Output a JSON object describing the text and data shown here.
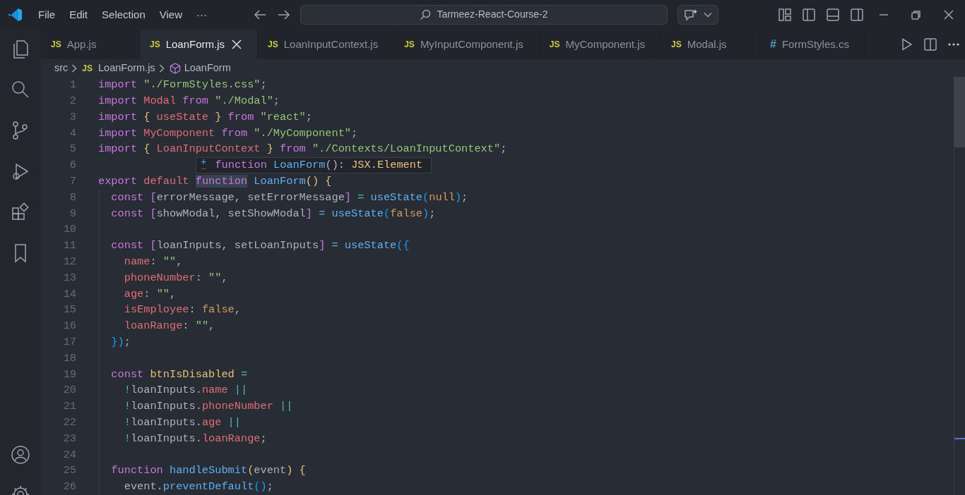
{
  "menu_bar": {
    "items": [
      "File",
      "Edit",
      "Selection",
      "View",
      "···"
    ]
  },
  "command_center": {
    "text": "Tarmeez-React-Course-2"
  },
  "tabs": [
    {
      "kind": "js",
      "badge": "JS",
      "label": "App.js",
      "selected": false
    },
    {
      "kind": "js",
      "badge": "JS",
      "label": "LoanForm.js",
      "selected": true
    },
    {
      "kind": "js",
      "badge": "JS",
      "label": "LoanInputContext.js",
      "selected": false
    },
    {
      "kind": "js",
      "badge": "JS",
      "label": "MyInputComponent.js",
      "selected": false
    },
    {
      "kind": "js",
      "badge": "JS",
      "label": "MyComponent.js",
      "selected": false
    },
    {
      "kind": "js",
      "badge": "JS",
      "label": "Modal.js",
      "selected": false
    },
    {
      "kind": "css",
      "badge": "#",
      "label": "FormStyles.cs",
      "selected": false
    }
  ],
  "breadcrumb": [
    {
      "kind": "folder",
      "label": "src"
    },
    {
      "kind": "file",
      "badge": "JS",
      "label": "LoanForm.js"
    },
    {
      "kind": "symbol",
      "label": "LoanForm"
    }
  ],
  "editor": {
    "lines": [
      {
        "number": "1",
        "tokens": [
          {
            "kind": "kw",
            "text": "import"
          },
          {
            "kind": "str",
            "text": " \"./FormStyles.css\""
          },
          {
            "kind": "p",
            "text": ";"
          }
        ]
      },
      {
        "number": "2",
        "tokens": [
          {
            "kind": "kw",
            "text": "import"
          },
          {
            "kind": "var",
            "text": " Modal"
          },
          {
            "kind": "kw",
            "text": " from"
          },
          {
            "kind": "str",
            "text": " \"./Modal\""
          },
          {
            "kind": "p",
            "text": ";"
          }
        ]
      },
      {
        "number": "3",
        "tokens": [
          {
            "kind": "kw",
            "text": "import"
          },
          {
            "kind": "y",
            "text": " {"
          },
          {
            "kind": "var",
            "text": " useState"
          },
          {
            "kind": "y",
            "text": " }"
          },
          {
            "kind": "kw",
            "text": " from"
          },
          {
            "kind": "str",
            "text": " \"react\""
          },
          {
            "kind": "p",
            "text": ";"
          }
        ]
      },
      {
        "number": "4",
        "tokens": [
          {
            "kind": "kw",
            "text": "import"
          },
          {
            "kind": "var",
            "text": " MyComponent"
          },
          {
            "kind": "kw",
            "text": " from"
          },
          {
            "kind": "str",
            "text": " \"./MyComponent\""
          },
          {
            "kind": "p",
            "text": ";"
          }
        ]
      },
      {
        "number": "5",
        "tokens": [
          {
            "kind": "kw",
            "text": "import"
          },
          {
            "kind": "y",
            "text": " {"
          },
          {
            "kind": "var",
            "text": " LoanInputContext"
          },
          {
            "kind": "y",
            "text": " }"
          },
          {
            "kind": "kw",
            "text": " from"
          },
          {
            "kind": "str",
            "text": " \"./Contexts/LoanInputContext\""
          },
          {
            "kind": "p",
            "text": ";"
          }
        ]
      },
      {
        "number": "6"
      },
      {
        "number": "7",
        "tokens": [
          {
            "kind": "kw",
            "text": "export"
          },
          {
            "kind": "var",
            "text": " default "
          },
          {
            "kind": "hl",
            "text": "function"
          },
          {
            "kind": "fn",
            "text": " LoanForm"
          },
          {
            "kind": "y",
            "text": "() {"
          }
        ]
      },
      {
        "number": "8",
        "tokens": [
          {
            "kind": "kw",
            "text": "  const "
          },
          {
            "kind": "pu",
            "text": "["
          },
          {
            "kind": "p",
            "text": "errorMessage, setErrorMessage"
          },
          {
            "kind": "pu",
            "text": "]"
          },
          {
            "kind": "c",
            "text": " ="
          },
          {
            "kind": "fn",
            "text": " useState"
          },
          {
            "kind": "b",
            "text": "("
          },
          {
            "kind": "o",
            "text": "null"
          },
          {
            "kind": "b",
            "text": ")"
          },
          {
            "kind": "p",
            "text": ";"
          }
        ]
      },
      {
        "number": "9",
        "tokens": [
          {
            "kind": "kw",
            "text": "  const "
          },
          {
            "kind": "pu",
            "text": "["
          },
          {
            "kind": "p",
            "text": "showModal, setShowModal"
          },
          {
            "kind": "pu",
            "text": "]"
          },
          {
            "kind": "c",
            "text": " ="
          },
          {
            "kind": "fn",
            "text": " useState"
          },
          {
            "kind": "b",
            "text": "("
          },
          {
            "kind": "o",
            "text": "false"
          },
          {
            "kind": "b",
            "text": ")"
          },
          {
            "kind": "p",
            "text": ";"
          }
        ]
      },
      {
        "number": "10"
      },
      {
        "number": "11",
        "tokens": [
          {
            "kind": "kw",
            "text": "  const "
          },
          {
            "kind": "pu",
            "text": "["
          },
          {
            "kind": "p",
            "text": "loanInputs, setLoanInputs"
          },
          {
            "kind": "pu",
            "text": "]"
          },
          {
            "kind": "c",
            "text": " ="
          },
          {
            "kind": "fn",
            "text": " useState"
          },
          {
            "kind": "b",
            "text": "({"
          }
        ]
      },
      {
        "number": "12",
        "tokens": [
          {
            "kind": "var",
            "text": "    name"
          },
          {
            "kind": "p",
            "text": ": "
          },
          {
            "kind": "str",
            "text": "\"\""
          },
          {
            "kind": "p",
            "text": ","
          }
        ]
      },
      {
        "number": "13",
        "tokens": [
          {
            "kind": "var",
            "text": "    phoneNumber"
          },
          {
            "kind": "p",
            "text": ": "
          },
          {
            "kind": "str",
            "text": "\"\""
          },
          {
            "kind": "p",
            "text": ","
          }
        ]
      },
      {
        "number": "14",
        "tokens": [
          {
            "kind": "var",
            "text": "    age"
          },
          {
            "kind": "p",
            "text": ": "
          },
          {
            "kind": "str",
            "text": "\"\""
          },
          {
            "kind": "p",
            "text": ","
          }
        ]
      },
      {
        "number": "15",
        "tokens": [
          {
            "kind": "var",
            "text": "    isEmployee"
          },
          {
            "kind": "p",
            "text": ": "
          },
          {
            "kind": "o",
            "text": "false"
          },
          {
            "kind": "p",
            "text": ","
          }
        ]
      },
      {
        "number": "16",
        "tokens": [
          {
            "kind": "var",
            "text": "    loanRange"
          },
          {
            "kind": "p",
            "text": ": "
          },
          {
            "kind": "str",
            "text": "\"\""
          },
          {
            "kind": "p",
            "text": ","
          }
        ]
      },
      {
        "number": "17",
        "tokens": [
          {
            "kind": "b",
            "text": "  })"
          },
          {
            "kind": "p",
            "text": ";"
          }
        ]
      },
      {
        "number": "18"
      },
      {
        "number": "19",
        "tokens": [
          {
            "kind": "kw",
            "text": "  const "
          },
          {
            "kind": "y",
            "text": "btnIsDisabled"
          },
          {
            "kind": "c",
            "text": " ="
          }
        ]
      },
      {
        "number": "20",
        "tokens": [
          {
            "kind": "c",
            "text": "    !"
          },
          {
            "kind": "p",
            "text": "loanInputs."
          },
          {
            "kind": "var",
            "text": "name"
          },
          {
            "kind": "c",
            "text": " ||"
          }
        ]
      },
      {
        "number": "21",
        "tokens": [
          {
            "kind": "c",
            "text": "    !"
          },
          {
            "kind": "p",
            "text": "loanInputs."
          },
          {
            "kind": "var",
            "text": "phoneNumber"
          },
          {
            "kind": "c",
            "text": " ||"
          }
        ]
      },
      {
        "number": "22",
        "tokens": [
          {
            "kind": "c",
            "text": "    !"
          },
          {
            "kind": "p",
            "text": "loanInputs."
          },
          {
            "kind": "var",
            "text": "age"
          },
          {
            "kind": "c",
            "text": " ||"
          }
        ]
      },
      {
        "number": "23",
        "tokens": [
          {
            "kind": "c",
            "text": "    !"
          },
          {
            "kind": "p",
            "text": "loanInputs."
          },
          {
            "kind": "var",
            "text": "loanRange"
          },
          {
            "kind": "p",
            "text": ";"
          }
        ]
      },
      {
        "number": "24"
      },
      {
        "number": "25",
        "tokens": [
          {
            "kind": "kw",
            "text": "  function"
          },
          {
            "kind": "fn",
            "text": " handleSubmit"
          },
          {
            "kind": "y",
            "text": "("
          },
          {
            "kind": "p",
            "text": "event"
          },
          {
            "kind": "y",
            "text": ") {"
          }
        ]
      },
      {
        "number": "26",
        "tokens": [
          {
            "kind": "p",
            "text": "    event."
          },
          {
            "kind": "fn",
            "text": "preventDefault"
          },
          {
            "kind": "b",
            "text": "()"
          },
          {
            "kind": "p",
            "text": ";"
          }
        ]
      }
    ]
  },
  "hover": {
    "expand": "+",
    "collapse": "−",
    "signature": [
      {
        "kind": "kw",
        "text": "function"
      },
      {
        "kind": "fn",
        "text": " LoanForm"
      },
      {
        "kind": "p",
        "text": "(): "
      },
      {
        "kind": "y",
        "text": "JSX.Element"
      }
    ]
  }
}
